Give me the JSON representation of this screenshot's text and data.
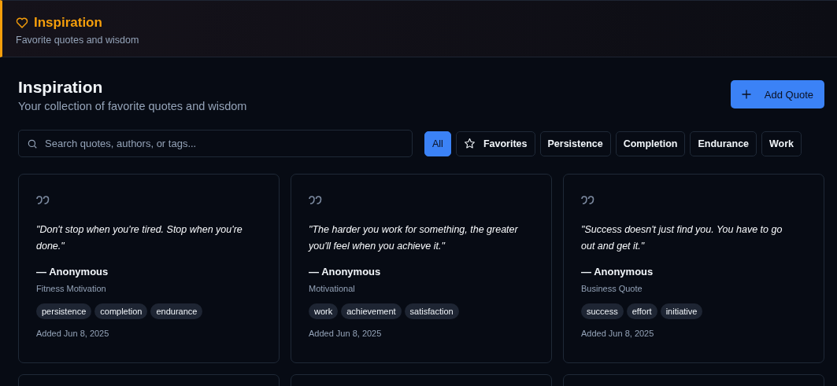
{
  "header": {
    "title": "Inspiration",
    "subtitle": "Favorite quotes and wisdom"
  },
  "page": {
    "title": "Inspiration",
    "subtitle": "Your collection of favorite quotes and wisdom",
    "add_button": "Add Quote"
  },
  "search": {
    "placeholder": "Search quotes, authors, or tags..."
  },
  "filters": [
    {
      "label": "All",
      "selected": true,
      "kind": "plain"
    },
    {
      "label": "Favorites",
      "selected": false,
      "kind": "star"
    },
    {
      "label": "Persistence",
      "selected": false,
      "kind": "plain"
    },
    {
      "label": "Completion",
      "selected": false,
      "kind": "plain"
    },
    {
      "label": "Endurance",
      "selected": false,
      "kind": "plain"
    },
    {
      "label": "Work",
      "selected": false,
      "kind": "plain"
    }
  ],
  "quotes": [
    {
      "text": "\"Don't stop when you're tired. Stop when you're done.\"",
      "author": "— Anonymous",
      "source": "Fitness Motivation",
      "tags": [
        "persistence",
        "completion",
        "endurance"
      ],
      "added": "Added Jun 8, 2025"
    },
    {
      "text": "\"The harder you work for something, the greater you'll feel when you achieve it.\"",
      "author": "— Anonymous",
      "source": "Motivational",
      "tags": [
        "work",
        "achievement",
        "satisfaction"
      ],
      "added": "Added Jun 8, 2025"
    },
    {
      "text": "\"Success doesn't just find you. You have to go out and get it.\"",
      "author": "— Anonymous",
      "source": "Business Quote",
      "tags": [
        "success",
        "effort",
        "initiative"
      ],
      "added": "Added Jun 8, 2025"
    }
  ],
  "partial_cards": [
    {
      "kind": "card"
    },
    {
      "kind": "card"
    },
    {
      "kind": "card"
    }
  ]
}
